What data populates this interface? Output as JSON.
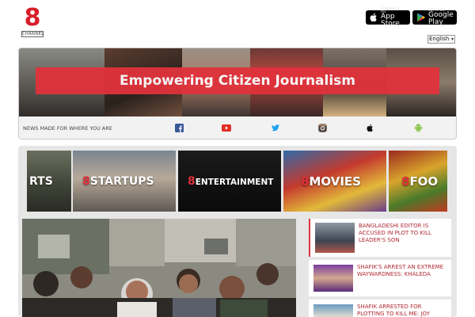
{
  "header": {
    "logo_mark": "8",
    "logo_text": "CHANNEL",
    "app_store": {
      "small": "Available on the",
      "large": "App Store"
    },
    "google_play": {
      "small": "GET IT ON",
      "large": "Google Play"
    },
    "language_select": {
      "selected": "English"
    }
  },
  "banner": {
    "headline": "Empowering Citizen Journalism",
    "tagline": "NEWS MADE FOR WHERE YOU ARE",
    "social_icons": [
      "facebook-icon",
      "youtube-icon",
      "twitter-icon",
      "instagram-icon",
      "apple-icon",
      "android-icon"
    ]
  },
  "categories": [
    {
      "label": "RTS",
      "mark": ""
    },
    {
      "label": "STARTUPS",
      "mark": "8"
    },
    {
      "label": "ENTERTAINMENT",
      "mark": "8"
    },
    {
      "label": "MOVIES",
      "mark": "8"
    },
    {
      "label": "FOO",
      "mark": "8"
    }
  ],
  "news": [
    {
      "title": "BANGLADESHI EDITOR IS ACCUSED IN PLOT TO KILL LEADER'S SON"
    },
    {
      "title": "SHAFIK'S ARREST AN EXTREME WAYWARDNESS: KHALEDA"
    },
    {
      "title": "SHAFIK ARRESTED FOR PLOTTING TO KILL ME: JOY"
    }
  ],
  "colors": {
    "brand_red": "#e0323b",
    "news_title": "#b02a32"
  }
}
